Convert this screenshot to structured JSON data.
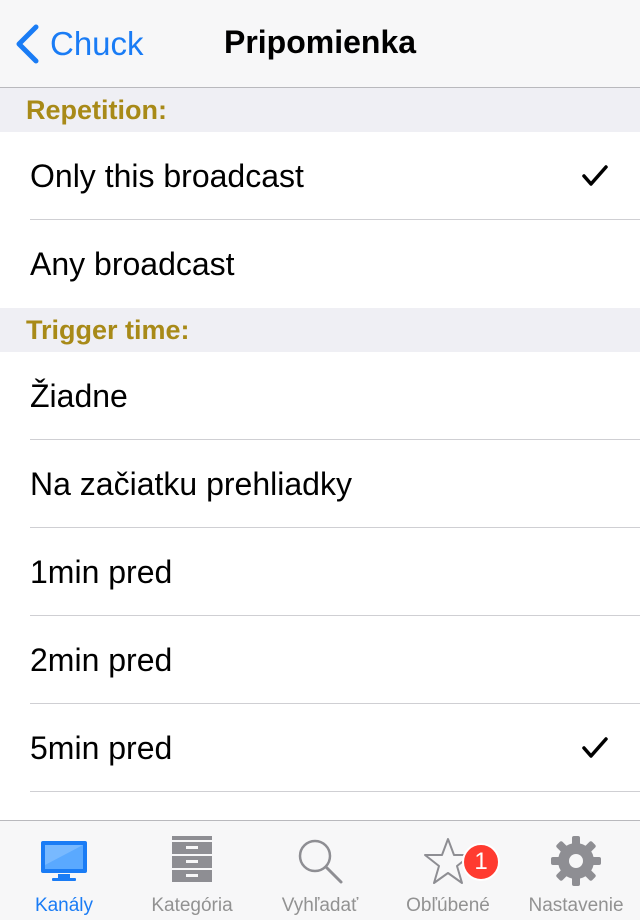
{
  "navbar": {
    "back_label": "Chuck",
    "title": "Pripomienka"
  },
  "sections": {
    "repetition": {
      "header": "Repetition:",
      "items": [
        {
          "label": "Only this broadcast",
          "checked": true
        },
        {
          "label": "Any broadcast",
          "checked": false
        }
      ]
    },
    "trigger": {
      "header": "Trigger time:",
      "items": [
        {
          "label": "Žiadne",
          "checked": false
        },
        {
          "label": "Na začiatku prehliadky",
          "checked": false
        },
        {
          "label": "1min pred",
          "checked": false
        },
        {
          "label": "2min pred",
          "checked": false
        },
        {
          "label": "5min pred",
          "checked": true
        }
      ]
    }
  },
  "tabbar": {
    "tabs": [
      {
        "label": "Kanály",
        "icon": "monitor-icon",
        "active": true
      },
      {
        "label": "Kategória",
        "icon": "cabinet-icon",
        "active": false
      },
      {
        "label": "Vyhľadať",
        "icon": "search-icon",
        "active": false
      },
      {
        "label": "Obľúbené",
        "icon": "star-icon",
        "active": false,
        "badge": "1"
      },
      {
        "label": "Nastavenie",
        "icon": "gear-icon",
        "active": false
      }
    ]
  },
  "colors": {
    "accent": "#1a7cf5",
    "section_header_text": "#a88a18",
    "badge": "#ff3b30"
  }
}
